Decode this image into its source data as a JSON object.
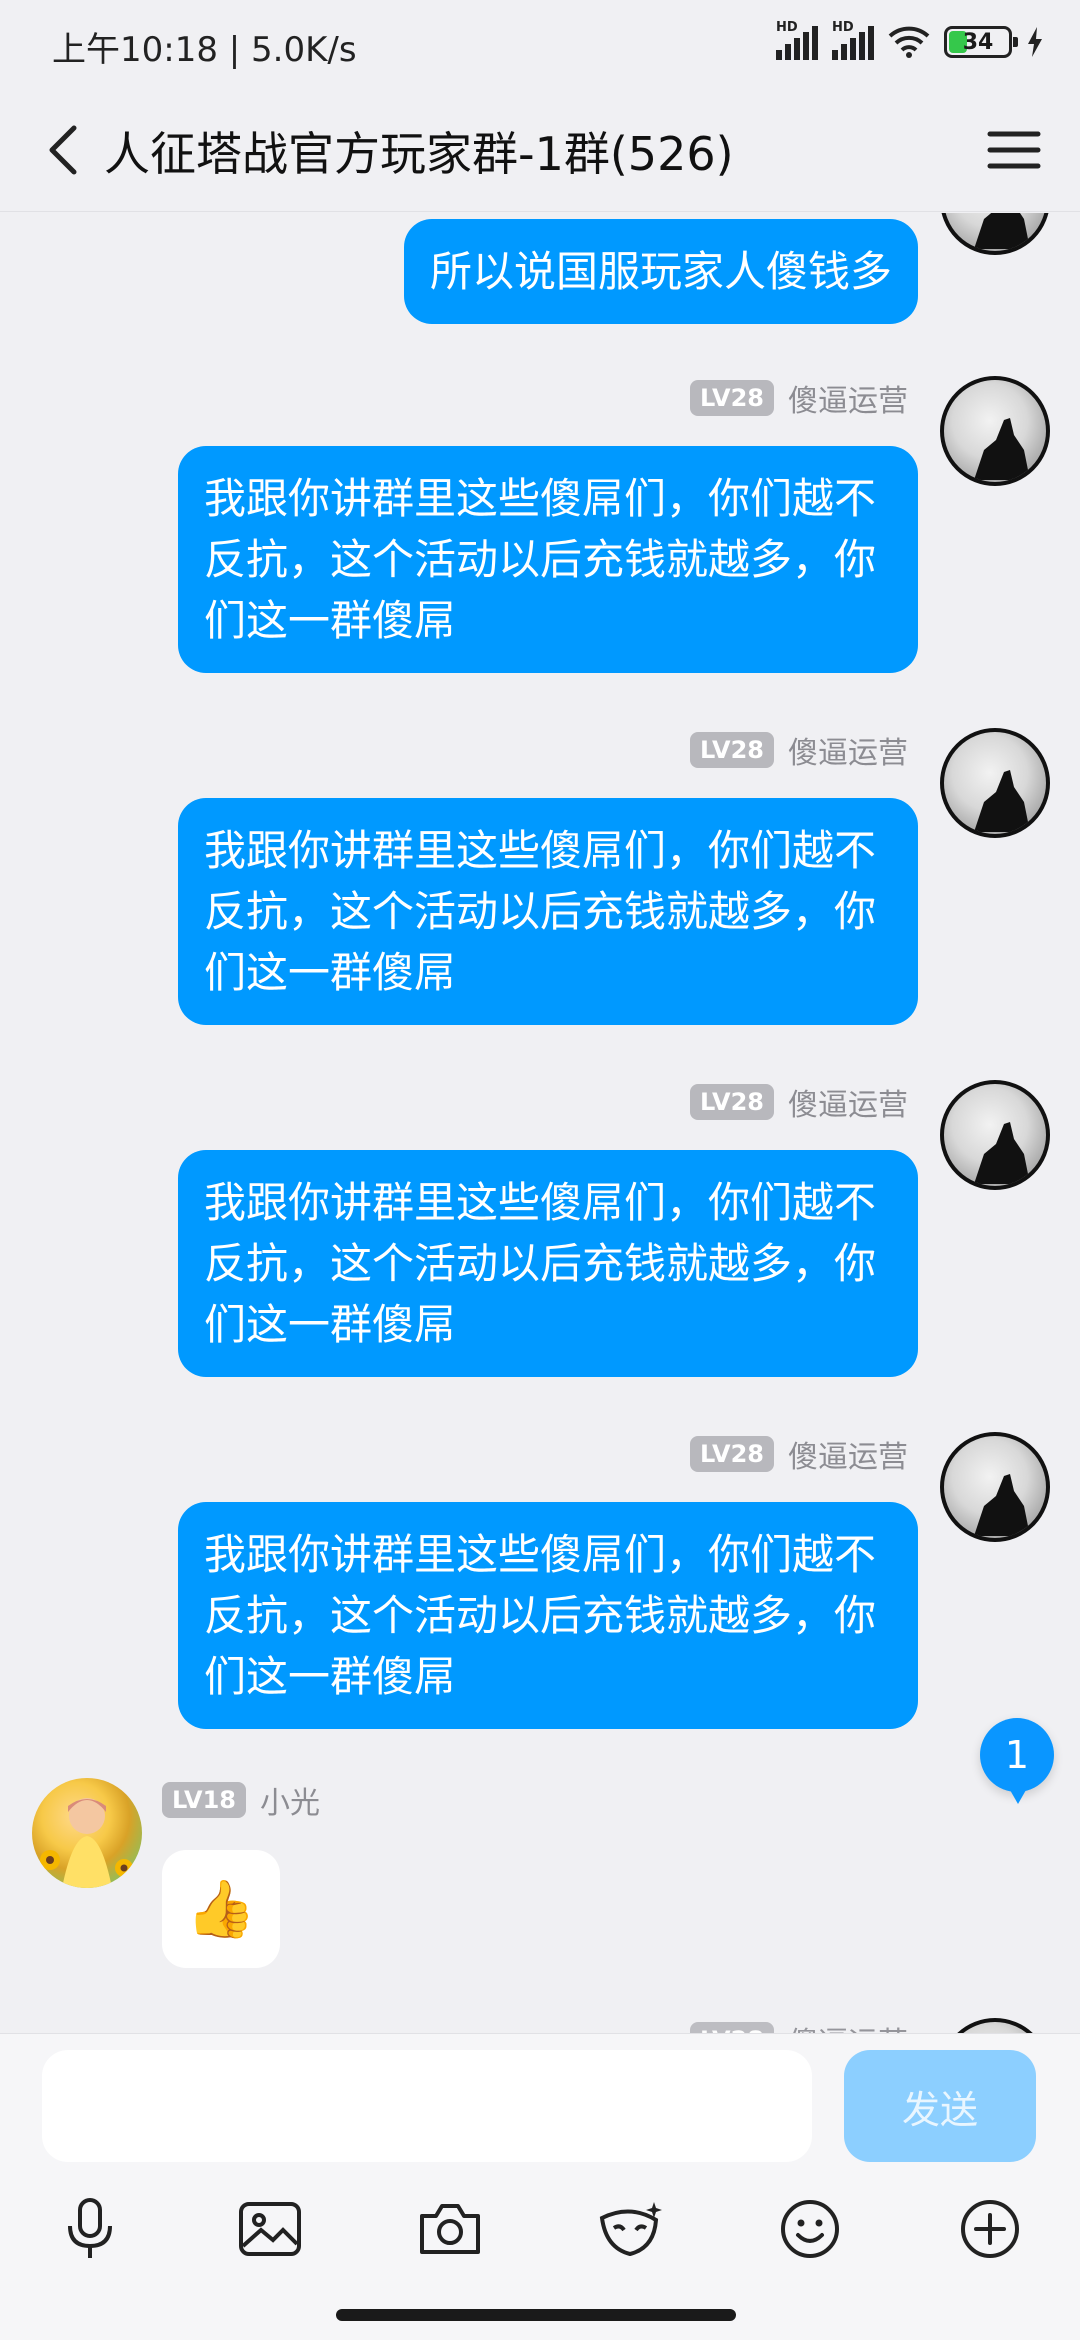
{
  "status": {
    "time": "上午10:18 | 5.0K/s",
    "battery": "34",
    "hd1": "HD",
    "hd2": "HD"
  },
  "header": {
    "title": "人征塔战官方玩家群-1群(526)"
  },
  "messages": [
    {
      "text": "所以说国服玩家人傻钱多"
    },
    {
      "lv": "LV28",
      "sender": "傻逼运营",
      "text": "我跟你讲群里这些傻屌们，你们越不反抗，这个活动以后充钱就越多，你们这一群傻屌"
    },
    {
      "lv": "LV28",
      "sender": "傻逼运营",
      "text": "我跟你讲群里这些傻屌们，你们越不反抗，这个活动以后充钱就越多，你们这一群傻屌"
    },
    {
      "lv": "LV28",
      "sender": "傻逼运营",
      "text": "我跟你讲群里这些傻屌们，你们越不反抗，这个活动以后充钱就越多，你们这一群傻屌"
    },
    {
      "lv": "LV28",
      "sender": "傻逼运营",
      "text": "我跟你讲群里这些傻屌们，你们越不反抗，这个活动以后充钱就越多，你们这一群傻屌"
    }
  ],
  "incoming": {
    "lv": "LV18",
    "sender": "小光",
    "content": "👍"
  },
  "unread_count": "1",
  "input": {
    "placeholder": "",
    "send_label": "发送"
  },
  "colors": {
    "bubble": "#0099ff",
    "send_disabled": "#8ccfff"
  }
}
